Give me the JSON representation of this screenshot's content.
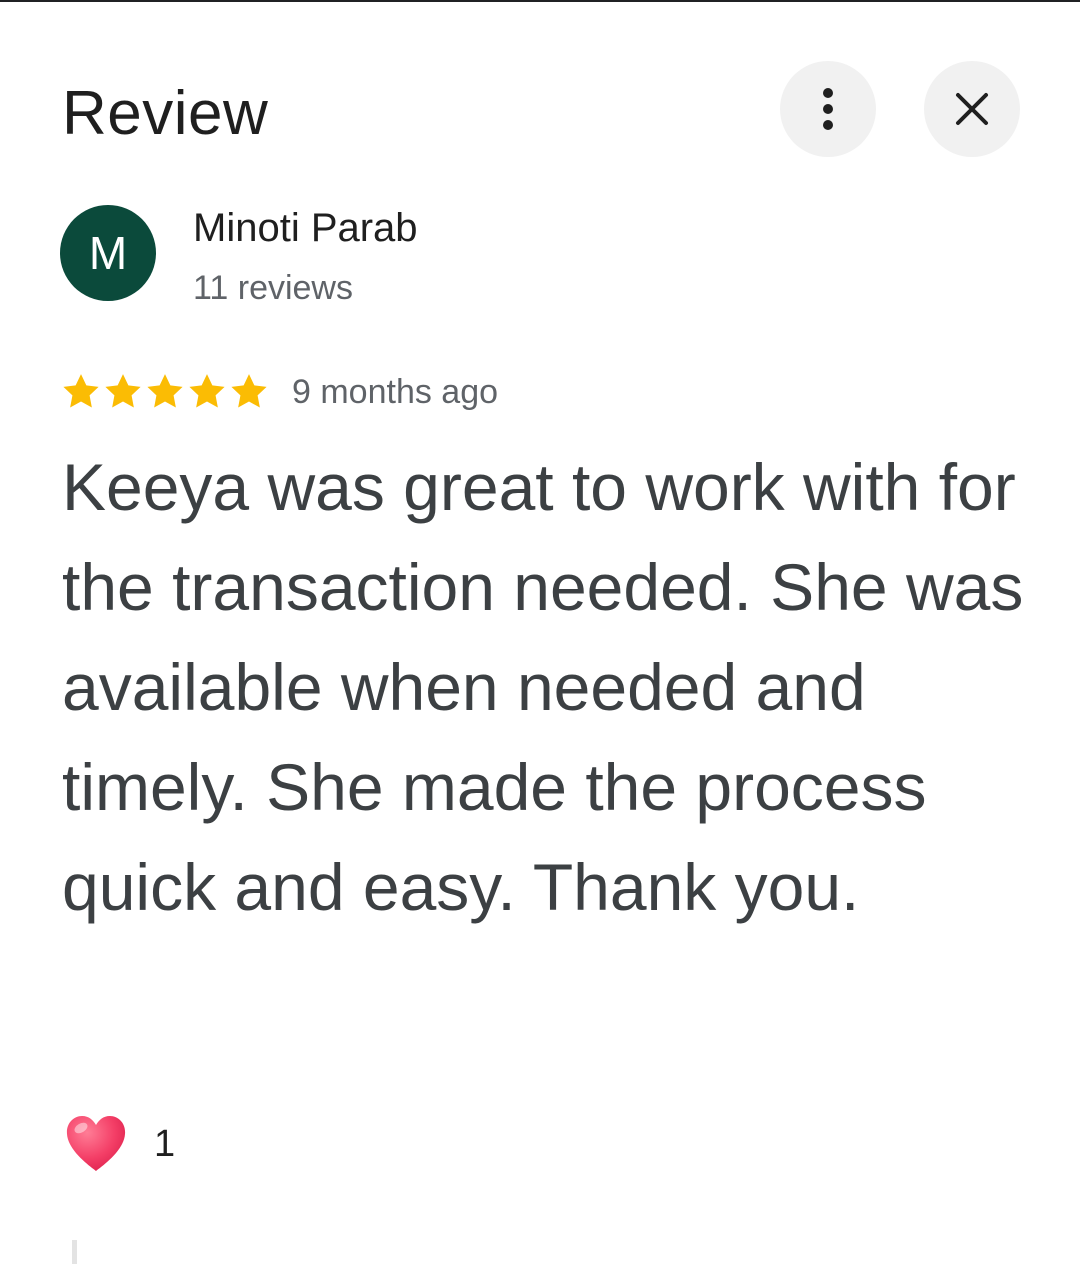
{
  "header": {
    "title": "Review",
    "more_icon": "more-vert-icon",
    "close_icon": "close-icon"
  },
  "author": {
    "initial": "M",
    "name": "Minoti Parab",
    "reviews": "11 reviews",
    "avatar_color": "#0b4a3b"
  },
  "rating": {
    "stars": 5,
    "max_stars": 5,
    "star_color": "#fbbc04",
    "time": "9 months ago"
  },
  "review": {
    "text": "Keeya was great to work with for the transaction needed. She was available when needed and timely. She made the process quick and easy. Thank you."
  },
  "reactions": {
    "icon": "heart-icon",
    "count": "1"
  }
}
